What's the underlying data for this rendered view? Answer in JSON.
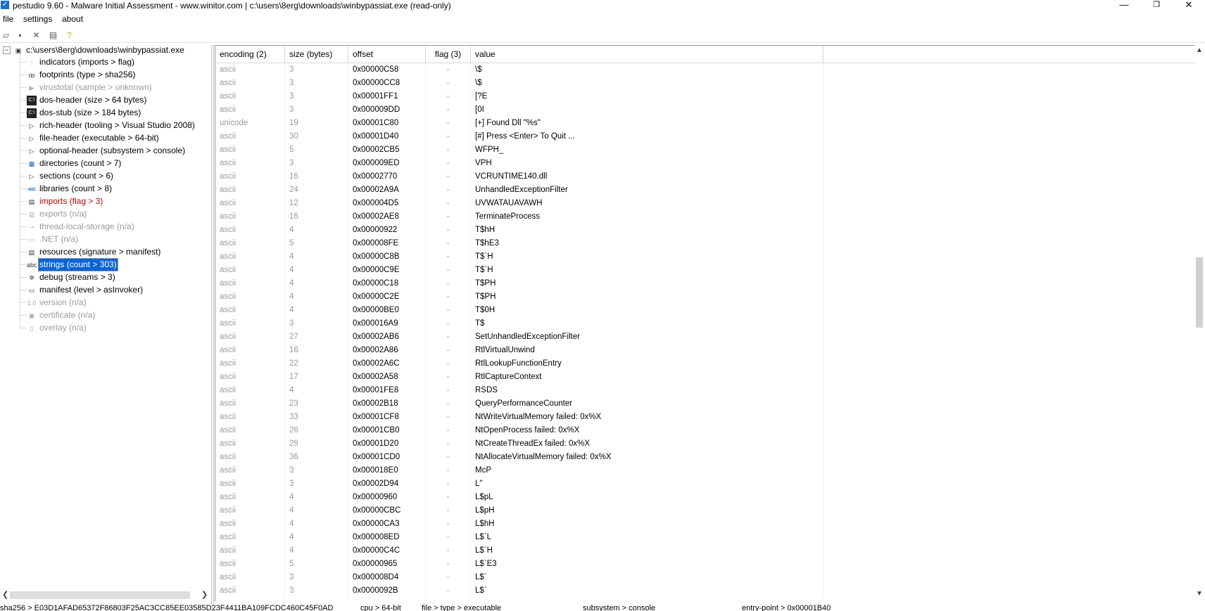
{
  "window": {
    "title": "pestudio 9.60 - Malware Initial Assessment - www.winitor.com | c:\\users\\8erg\\downloads\\winbypassiat.exe (read-only)",
    "minimize": "—",
    "restore": "❐",
    "close": "✕"
  },
  "menu": [
    "file",
    "settings",
    "about"
  ],
  "toolbar_icons": [
    "open-icon",
    "save-icon",
    "close-file-icon",
    "export-icon",
    "help-icon"
  ],
  "tree": {
    "root": "c:\\users\\8erg\\downloads\\winbypassiat.exe",
    "items": [
      {
        "label": "indicators (imports > flag)",
        "icon": "chart",
        "state": "normal"
      },
      {
        "label": "footprints (type > sha256)",
        "icon": "footprint",
        "state": "normal"
      },
      {
        "label": "virustotal (sample > unknown)",
        "icon": "play",
        "state": "dim"
      },
      {
        "label": "dos-header (size > 64 bytes)",
        "icon": "terminal",
        "state": "normal"
      },
      {
        "label": "dos-stub (size > 184 bytes)",
        "icon": "terminal",
        "state": "normal"
      },
      {
        "label": "rich-header (tooling > Visual Studio 2008)",
        "icon": "expand",
        "state": "normal"
      },
      {
        "label": "file-header (executable > 64-bit)",
        "icon": "expand",
        "state": "normal"
      },
      {
        "label": "optional-header (subsystem > console)",
        "icon": "expand",
        "state": "normal"
      },
      {
        "label": "directories (count > 7)",
        "icon": "grid",
        "state": "normal"
      },
      {
        "label": "sections (count > 6)",
        "icon": "expand",
        "state": "normal"
      },
      {
        "label": "libraries (count > 8)",
        "icon": "network",
        "state": "normal"
      },
      {
        "label": "imports (flag > 3)",
        "icon": "list",
        "state": "red"
      },
      {
        "label": "exports (n/a)",
        "icon": "list",
        "state": "dim"
      },
      {
        "label": "thread-local-storage (n/a)",
        "icon": "key",
        "state": "dim"
      },
      {
        "label": ".NET (n/a)",
        "icon": "doc",
        "state": "dim"
      },
      {
        "label": "resources (signature > manifest)",
        "icon": "list",
        "state": "normal"
      },
      {
        "label": "strings (count > 303)",
        "icon": "abc",
        "state": "selected"
      },
      {
        "label": "debug (streams > 3)",
        "icon": "bug",
        "state": "normal"
      },
      {
        "label": "manifest (level > asInvoker)",
        "icon": "doc",
        "state": "normal"
      },
      {
        "label": "version (n/a)",
        "icon": "ver",
        "state": "dim"
      },
      {
        "label": "certificate (n/a)",
        "icon": "cert",
        "state": "dim"
      },
      {
        "label": "overlay (n/a)",
        "icon": "page",
        "state": "dim"
      }
    ],
    "icon_glyphs": {
      "chart": "⫶",
      "footprint": "ꝏ",
      "play": "▶",
      "terminal": "C:\\",
      "expand": "▷",
      "grid": "▦",
      "network": "⋘",
      "list": "▤",
      "key": "⊸",
      "doc": "▭",
      "abc": "abc",
      "bug": "✲",
      "ver": "1.0",
      "cert": "▣",
      "page": "▯"
    }
  },
  "table": {
    "columns": [
      "encoding (2)",
      "size (bytes)",
      "offset",
      "flag (3)",
      "value"
    ],
    "rows": [
      [
        "ascii",
        "3",
        "0x00000C58",
        "-",
        "\\$"
      ],
      [
        "ascii",
        "3",
        "0x00000CC8",
        "-",
        "\\$"
      ],
      [
        "ascii",
        "3",
        "0x00001FF1",
        "-",
        "[?E"
      ],
      [
        "ascii",
        "3",
        "0x000009DD",
        "-",
        "[0I"
      ],
      [
        "unicode",
        "19",
        "0x00001C80",
        "-",
        "[+] Found Dll \"%s\""
      ],
      [
        "ascii",
        "30",
        "0x00001D40",
        "-",
        "[#] Press <Enter> To Quit ..."
      ],
      [
        "ascii",
        "5",
        "0x00002CB5",
        "-",
        "WFPH_"
      ],
      [
        "ascii",
        "3",
        "0x000009ED",
        "-",
        "VPH"
      ],
      [
        "ascii",
        "16",
        "0x00002770",
        "-",
        "VCRUNTIME140.dll"
      ],
      [
        "ascii",
        "24",
        "0x00002A9A",
        "-",
        "UnhandledExceptionFilter"
      ],
      [
        "ascii",
        "12",
        "0x000004D5",
        "-",
        "UVWATAUAVAWH"
      ],
      [
        "ascii",
        "16",
        "0x00002AE8",
        "-",
        "TerminateProcess"
      ],
      [
        "ascii",
        "4",
        "0x00000922",
        "-",
        "T$hH"
      ],
      [
        "ascii",
        "5",
        "0x000008FE",
        "-",
        "T$hE3"
      ],
      [
        "ascii",
        "4",
        "0x00000C8B",
        "-",
        "T$`H"
      ],
      [
        "ascii",
        "4",
        "0x00000C9E",
        "-",
        "T$`H"
      ],
      [
        "ascii",
        "4",
        "0x00000C18",
        "-",
        "T$PH"
      ],
      [
        "ascii",
        "4",
        "0x00000C2E",
        "-",
        "T$PH"
      ],
      [
        "ascii",
        "4",
        "0x00000BE0",
        "-",
        "T$0H"
      ],
      [
        "ascii",
        "3",
        "0x000016A9",
        "-",
        "T$"
      ],
      [
        "ascii",
        "27",
        "0x00002AB6",
        "-",
        "SetUnhandledExceptionFilter"
      ],
      [
        "ascii",
        "16",
        "0x00002A86",
        "-",
        "RtlVirtualUnwind"
      ],
      [
        "ascii",
        "22",
        "0x00002A6C",
        "-",
        "RtlLookupFunctionEntry"
      ],
      [
        "ascii",
        "17",
        "0x00002A58",
        "-",
        "RtlCaptureContext"
      ],
      [
        "ascii",
        "4",
        "0x00001FE8",
        "-",
        "RSDS"
      ],
      [
        "ascii",
        "23",
        "0x00002B18",
        "-",
        "QueryPerformanceCounter"
      ],
      [
        "ascii",
        "33",
        "0x00001CF8",
        "-",
        "NtWriteVirtualMemory failed: 0x%X"
      ],
      [
        "ascii",
        "26",
        "0x00001CB0",
        "-",
        "NtOpenProcess failed: 0x%X"
      ],
      [
        "ascii",
        "29",
        "0x00001D20",
        "-",
        "NtCreateThreadEx failed: 0x%X"
      ],
      [
        "ascii",
        "36",
        "0x00001CD0",
        "-",
        "NtAllocateVirtualMemory failed: 0x%X"
      ],
      [
        "ascii",
        "3",
        "0x000018E0",
        "-",
        "McP"
      ],
      [
        "ascii",
        "3",
        "0x00002D94",
        "-",
        "L''"
      ],
      [
        "ascii",
        "4",
        "0x00000960",
        "-",
        "L$pL"
      ],
      [
        "ascii",
        "4",
        "0x00000CBC",
        "-",
        "L$pH"
      ],
      [
        "ascii",
        "4",
        "0x00000CA3",
        "-",
        "L$hH"
      ],
      [
        "ascii",
        "4",
        "0x000008ED",
        "-",
        "L$`L"
      ],
      [
        "ascii",
        "4",
        "0x00000C4C",
        "-",
        "L$`H"
      ],
      [
        "ascii",
        "5",
        "0x00000965",
        "-",
        "L$`E3"
      ],
      [
        "ascii",
        "3",
        "0x000008D4",
        "-",
        "L$`"
      ],
      [
        "ascii",
        "3",
        "0x0000092B",
        "-",
        "L$`"
      ]
    ]
  },
  "status": {
    "sha256": "sha256 > E03D1AFAD65372F86803F25AC3CC85EE03585D23F4411BA109FCDC460C45F0AD",
    "cpu": "cpu > 64-bit",
    "file_type": "file > type > executable",
    "subsystem": "subsystem > console",
    "entry_point": "entry-point > 0x00001B40"
  }
}
